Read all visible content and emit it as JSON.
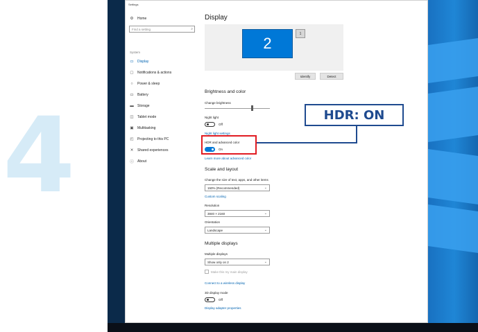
{
  "step_number": "4",
  "window": {
    "title": "Settings"
  },
  "sidebar": {
    "home": "Home",
    "search_placeholder": "Find a setting",
    "section_label": "System",
    "items": [
      {
        "label": "Display",
        "icon": "monitor-icon"
      },
      {
        "label": "Notifications & actions",
        "icon": "message-icon"
      },
      {
        "label": "Power & sleep",
        "icon": "power-icon"
      },
      {
        "label": "Battery",
        "icon": "battery-icon"
      },
      {
        "label": "Storage",
        "icon": "storage-icon"
      },
      {
        "label": "Tablet mode",
        "icon": "tablet-icon"
      },
      {
        "label": "Multitasking",
        "icon": "multitasking-icon"
      },
      {
        "label": "Projecting to this PC",
        "icon": "projector-icon"
      },
      {
        "label": "Shared experiences",
        "icon": "shared-icon"
      },
      {
        "label": "About",
        "icon": "info-icon"
      }
    ]
  },
  "main": {
    "title": "Display",
    "monitor_primary": "2",
    "monitor_secondary": "1",
    "identify": "Identify",
    "detect": "Detect",
    "brightness": {
      "heading": "Brightness and color",
      "change_brightness": "Change brightness",
      "brightness_level": 0.72,
      "night_light_label": "Night light",
      "night_light_state": "Off",
      "night_light_settings": "Night light settings",
      "hdr_label": "HDR and advanced color",
      "hdr_state": "On",
      "hdr_link": "Learn more about advanced color"
    },
    "scale": {
      "heading": "Scale and layout",
      "size_label": "Change the size of text, apps, and other items",
      "size_value": "150% (Recommended)",
      "custom_scaling": "Custom scaling",
      "resolution_label": "Resolution",
      "resolution_value": "3840 × 2160",
      "orientation_label": "Orientation",
      "orientation_value": "Landscape"
    },
    "multiple": {
      "heading": "Multiple displays",
      "label": "Multiple displays",
      "value": "Show only on 2",
      "main_display": "Make this my main display",
      "wireless": "Connect to a wireless display",
      "mode_3d_label": "3D display mode",
      "mode_3d_state": "Off",
      "adapter": "Display adapter properties"
    }
  },
  "callout": {
    "text": "HDR: ON",
    "box_color": "#e11b22",
    "line_color": "#1e4a8f"
  },
  "accent": "#0078d7"
}
